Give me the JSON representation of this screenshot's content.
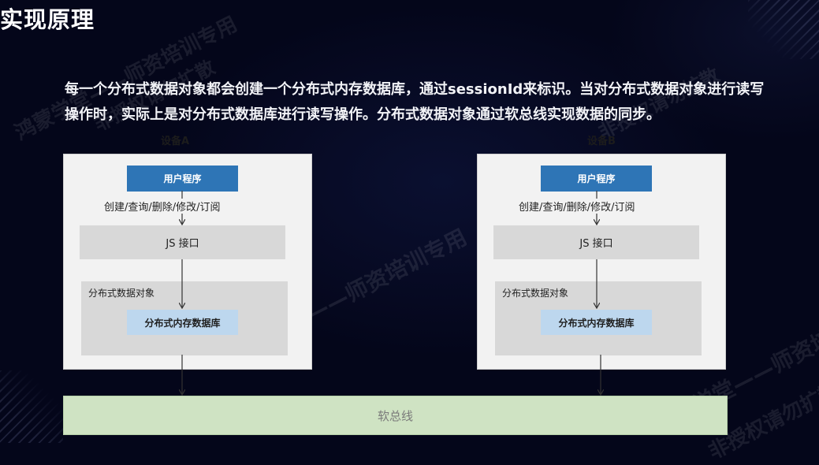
{
  "page": {
    "title": "实现原理",
    "intro_lines": [
      "每一个分布式数据对象都会创建一个分布式内存数据库，通过sessionId来标识。当对分布式数据对象进行读写",
      "操作时，实际上是对分布式数据库进行读写操作。分布式数据对象通过软总线实现数据的同步。"
    ]
  },
  "watermarks": [
    "鸿蒙学堂——师资培训专用",
    "非授权请勿扩散"
  ],
  "diagram": {
    "devices": [
      {
        "name": "设备A",
        "app": "用户程序",
        "operations": "创建/查询/删除/修改/订阅",
        "js_interface": "JS 接口",
        "object_layer": "分布式数据对象",
        "memory_db": "分布式内存数据库"
      },
      {
        "name": "设备B",
        "app": "用户程序",
        "operations": "创建/查询/删除/修改/订阅",
        "js_interface": "JS 接口",
        "object_layer": "分布式数据对象",
        "memory_db": "分布式内存数据库"
      }
    ],
    "softbus": "软总线"
  },
  "colors": {
    "background": "#04061a",
    "app_box": "#2e75b6",
    "memory_db_box": "#bdd7ee",
    "layer_box": "#d8d8d8",
    "device_box": "#f2f2f2",
    "softbus": "#cfe3c3"
  }
}
